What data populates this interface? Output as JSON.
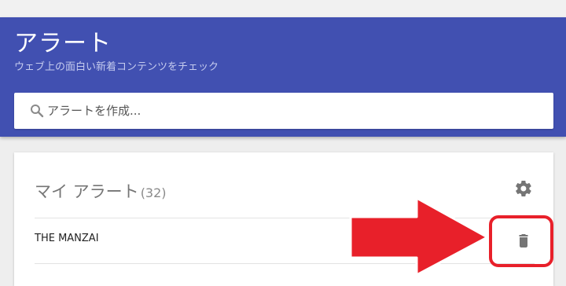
{
  "header": {
    "title": "アラート",
    "subtitle": "ウェブ上の面白い新着コンテンツをチェック"
  },
  "search": {
    "placeholder": "アラートを作成..."
  },
  "my_alerts": {
    "title": "マイ アラート",
    "count": "(32)",
    "items": [
      {
        "label": "THE MANZAI"
      }
    ]
  },
  "icons": {
    "search": "search-icon",
    "settings": "gear-icon",
    "delete": "trash-icon",
    "annotation_arrow": "arrow-right-icon"
  },
  "colors": {
    "header_bg": "#4150b1",
    "accent_red": "#e8202a",
    "icon_gray": "#757575"
  }
}
